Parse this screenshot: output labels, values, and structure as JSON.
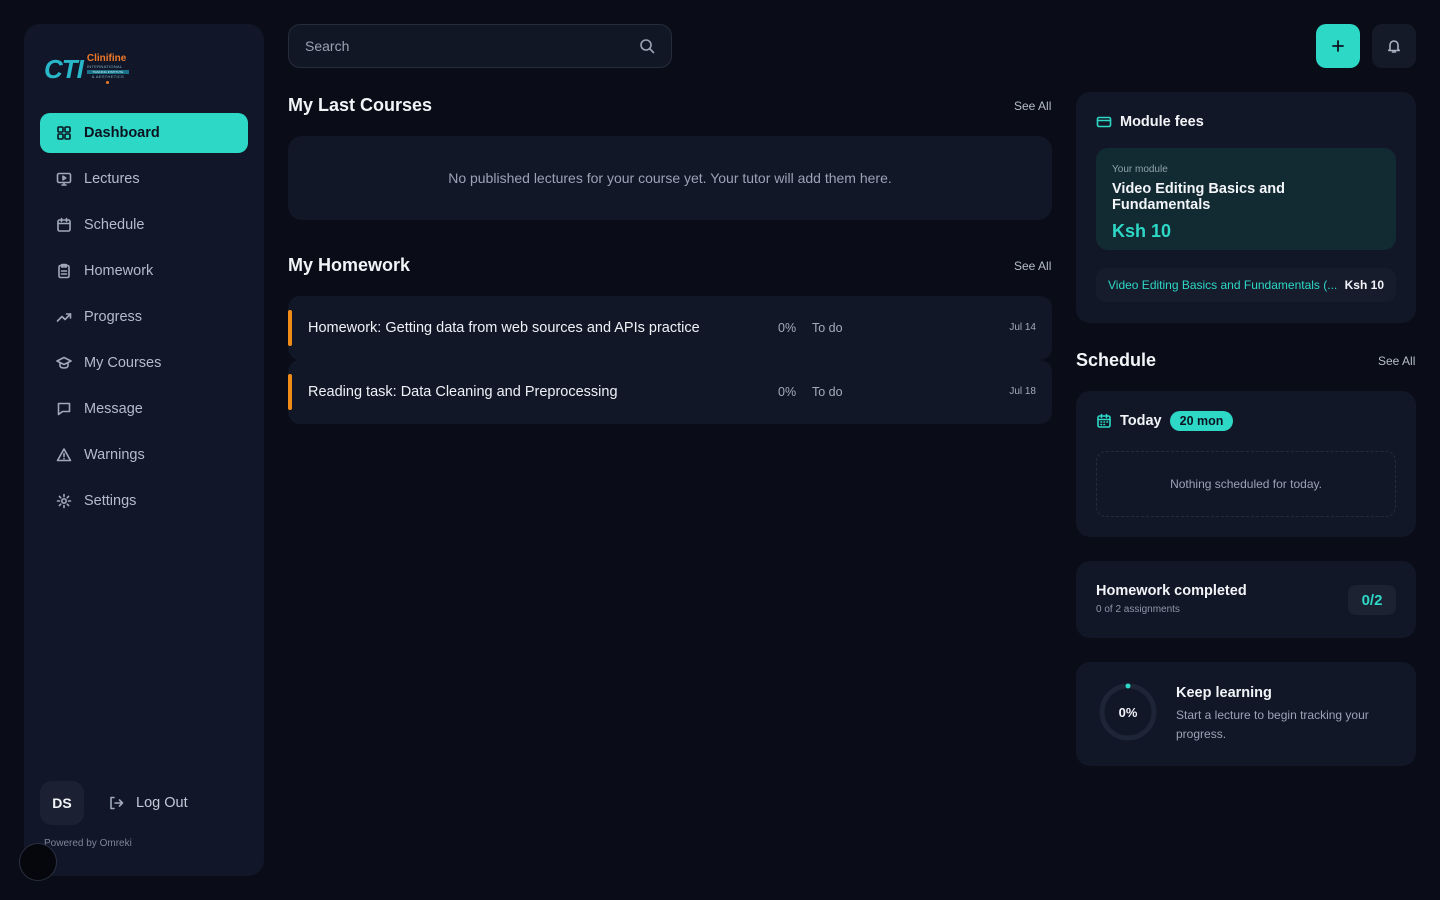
{
  "brand": {
    "logo_main": "CTI",
    "logo_name": "Clinifine",
    "logo_sub": "INTERNATIONAL",
    "logo_tag": "TRAINING INSTITUTE",
    "logo_tag2": "& AESTHETICS"
  },
  "sidebar": {
    "items": [
      {
        "label": "Dashboard",
        "icon": "grid-icon",
        "active": true
      },
      {
        "label": "Lectures",
        "icon": "monitor-play-icon"
      },
      {
        "label": "Schedule",
        "icon": "calendar-icon"
      },
      {
        "label": "Homework",
        "icon": "clipboard-icon"
      },
      {
        "label": "Progress",
        "icon": "trending-up-icon"
      },
      {
        "label": "My Courses",
        "icon": "graduation-cap-icon"
      },
      {
        "label": "Message",
        "icon": "message-icon"
      },
      {
        "label": "Warnings",
        "icon": "warning-icon"
      },
      {
        "label": "Settings",
        "icon": "gear-icon"
      }
    ],
    "user_initials": "DS",
    "logout_label": "Log Out",
    "powered_by": "Powered by Omreki"
  },
  "search": {
    "placeholder": "Search"
  },
  "last_courses": {
    "title": "My Last Courses",
    "see_all": "See All",
    "empty_text": "No published lectures for your course yet. Your tutor will add them here."
  },
  "homework": {
    "title": "My Homework",
    "see_all": "See All",
    "items": [
      {
        "title": "Homework: Getting data from web sources and APIs practice",
        "progress": "0%",
        "status": "To do",
        "due": "Jul 14"
      },
      {
        "title": "Reading task: Data Cleaning and Preprocessing",
        "progress": "0%",
        "status": "To do",
        "due": "Jul 18"
      }
    ]
  },
  "module_fees": {
    "title": "Module fees",
    "caption": "Your module",
    "module_name": "Video Editing Basics and Fundamentals",
    "price": "Ksh 10",
    "line_name": "Video Editing Basics and Fundamentals (...",
    "line_price": "Ksh 10"
  },
  "schedule": {
    "title": "Schedule",
    "see_all": "See All",
    "today_label": "Today",
    "today_badge": "20 mon",
    "empty_text": "Nothing scheduled for today."
  },
  "homework_completed": {
    "title": "Homework completed",
    "subtitle": "0 of 2 assignments",
    "badge": "0/2"
  },
  "keep_learning": {
    "progress": "0%",
    "progress_fraction": 0,
    "title": "Keep learning",
    "text": "Start a lecture to begin tracking your progress."
  },
  "colors": {
    "accent": "#2dd8c6",
    "homework_bar": "#f28c18",
    "background": "#0a0d17",
    "panel": "#121727"
  }
}
